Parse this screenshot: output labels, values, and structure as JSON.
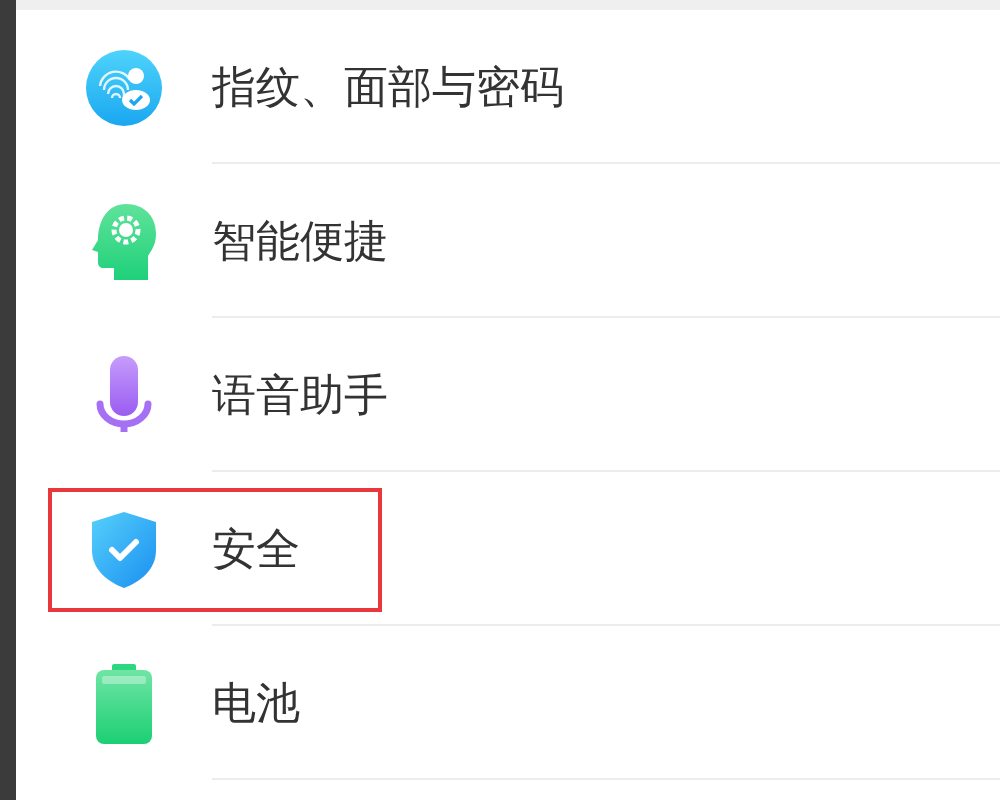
{
  "items": [
    {
      "label": "指纹、面部与密码",
      "highlighted": false
    },
    {
      "label": "智能便捷",
      "highlighted": false
    },
    {
      "label": "语音助手",
      "highlighted": false
    },
    {
      "label": "安全",
      "highlighted": true
    },
    {
      "label": "电池",
      "highlighted": false
    }
  ]
}
